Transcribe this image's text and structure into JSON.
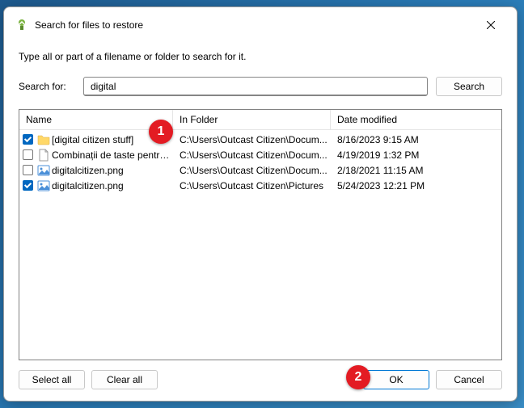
{
  "window": {
    "title": "Search for files to restore"
  },
  "instruction": "Type all or part of a filename or folder to search for it.",
  "search": {
    "label": "Search for:",
    "value": "digital",
    "button": "Search"
  },
  "columns": {
    "name": "Name",
    "folder": "In Folder",
    "date": "Date modified"
  },
  "results": [
    {
      "checked": true,
      "icon": "folder",
      "name": "[digital citizen stuff]",
      "folder": "C:\\Users\\Outcast Citizen\\Docum...",
      "date": "8/16/2023 9:15 AM"
    },
    {
      "checked": false,
      "icon": "document",
      "name": "Combinații de taste pentru ...",
      "folder": "C:\\Users\\Outcast Citizen\\Docum...",
      "date": "4/19/2019 1:32 PM"
    },
    {
      "checked": false,
      "icon": "image",
      "name": "digitalcitizen.png",
      "folder": "C:\\Users\\Outcast Citizen\\Docum...",
      "date": "2/18/2021 11:15 AM"
    },
    {
      "checked": true,
      "icon": "image",
      "name": "digitalcitizen.png",
      "folder": "C:\\Users\\Outcast Citizen\\Pictures",
      "date": "5/24/2023 12:21 PM"
    }
  ],
  "buttons": {
    "select_all": "Select all",
    "clear_all": "Clear all",
    "ok": "OK",
    "cancel": "Cancel"
  },
  "annotations": {
    "one": "1",
    "two": "2"
  }
}
